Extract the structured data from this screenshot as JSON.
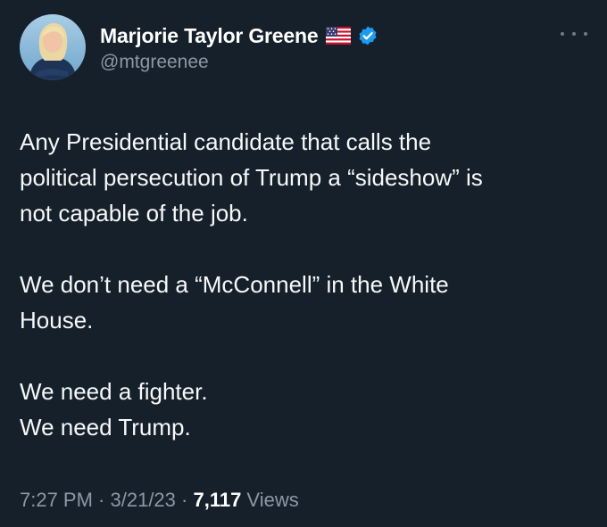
{
  "author": {
    "display_name": "Marjorie Taylor Greene",
    "handle": "@mtgreenee",
    "flag_icon": "us-flag-icon",
    "verified_icon": "verified-badge-icon",
    "verified_color": "#1d9bf0"
  },
  "menu": {
    "icon": "more-options-icon"
  },
  "tweet": {
    "lines": [
      "Any Presidential candidate that calls the",
      "political persecution of Trump a “sideshow” is",
      "not capable of the job.",
      "",
      "We don’t need a “McConnell” in the White",
      "House.",
      "",
      "We need a fighter.",
      "We need Trump."
    ]
  },
  "meta": {
    "time": "7:27 PM",
    "separator1": " · ",
    "date": "3/21/23",
    "separator2": " · ",
    "views_count": "7,117",
    "views_label": " Views"
  },
  "colors": {
    "background": "#15202b",
    "text": "#f7f9f9",
    "secondary": "#8b98a5"
  }
}
